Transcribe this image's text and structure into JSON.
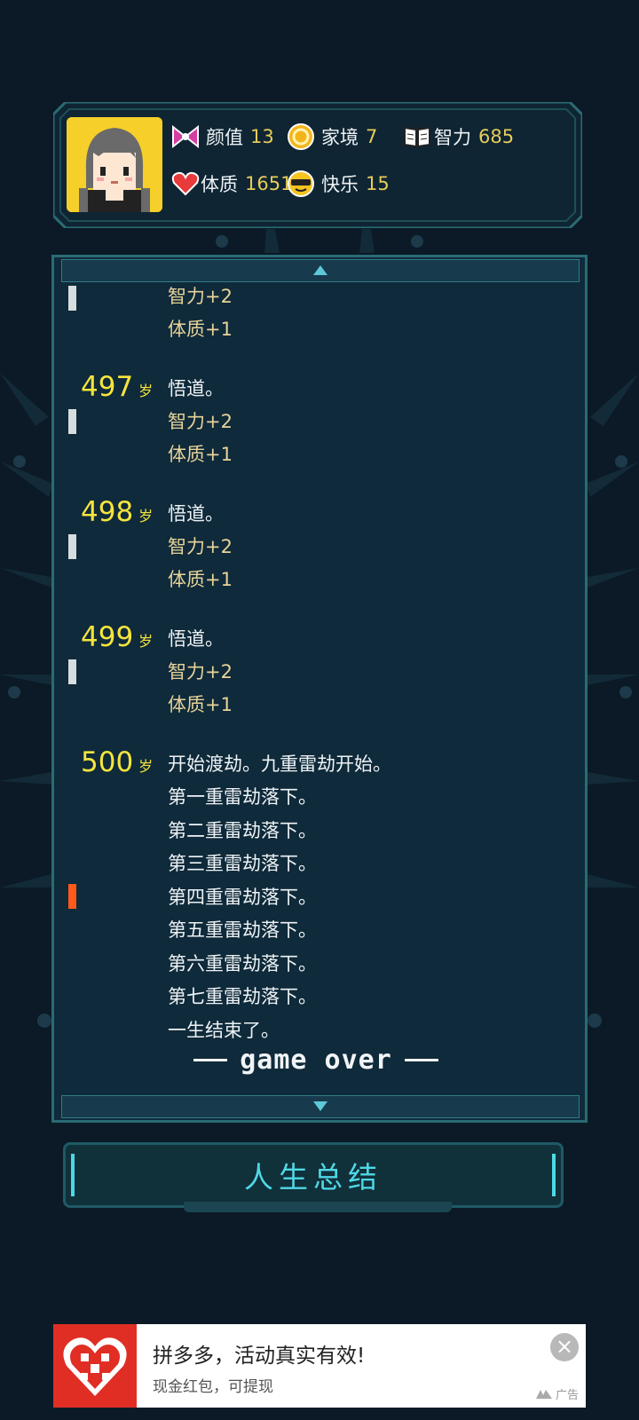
{
  "stats": [
    {
      "label": "颜值",
      "value": "13",
      "icon": "bow-icon"
    },
    {
      "label": "家境",
      "value": "7",
      "icon": "coin-icon"
    },
    {
      "label": "智力",
      "value": "685",
      "icon": "book-icon"
    },
    {
      "label": "体质",
      "value": "1651",
      "icon": "heart-icon"
    },
    {
      "label": "快乐",
      "value": "15",
      "icon": "sunglasses-face-icon"
    }
  ],
  "log": {
    "top_lines": [
      "智力+2",
      "体质+1"
    ],
    "entries": [
      {
        "age": "497",
        "age_unit": "岁",
        "lines": [
          "悟道。",
          "智力+2",
          "体质+1"
        ]
      },
      {
        "age": "498",
        "age_unit": "岁",
        "lines": [
          "悟道。",
          "智力+2",
          "体质+1"
        ]
      },
      {
        "age": "499",
        "age_unit": "岁",
        "lines": [
          "悟道。",
          "智力+2",
          "体质+1"
        ]
      },
      {
        "age": "500",
        "age_unit": "岁",
        "lines": [
          "开始渡劫。九重雷劫开始。",
          "第一重雷劫落下。",
          "第二重雷劫落下。",
          "第三重雷劫落下。",
          "第四重雷劫落下。",
          "第五重雷劫落下。",
          "第六重雷劫落下。",
          "第七重雷劫落下。",
          "一生结束了。"
        ]
      }
    ],
    "game_over": "game over"
  },
  "summary_button": "人生总结",
  "ad": {
    "logo_text": "拼",
    "title": "拼多多，活动真实有效!",
    "subtitle": "现金红包，可提现",
    "tag": "广告",
    "close": "×"
  },
  "colors": {
    "background": "#0b1a26",
    "panel": "#0f2a3a",
    "accent": "#4fd8e6",
    "age": "#f6e53c",
    "ad_brand": "#e02e24"
  }
}
